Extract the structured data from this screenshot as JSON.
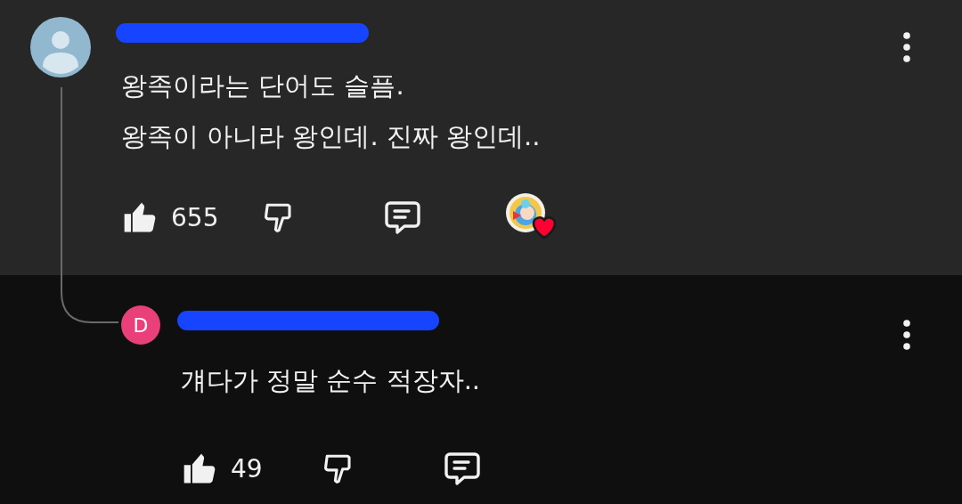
{
  "comments": [
    {
      "avatar": {
        "kind": "default"
      },
      "text_lines": [
        "왕족이라는 단어도 슬픔.",
        "왕족이 아니라 왕인데. 진짜 왕인데.."
      ],
      "likes": "655",
      "liked": true,
      "creator_heart": true
    },
    {
      "avatar": {
        "kind": "letter",
        "letter": "D",
        "color": "#e94079"
      },
      "text_lines": [
        "걔다가 정말 순수 적장자.."
      ],
      "likes": "49",
      "liked": true,
      "creator_heart": false
    }
  ]
}
